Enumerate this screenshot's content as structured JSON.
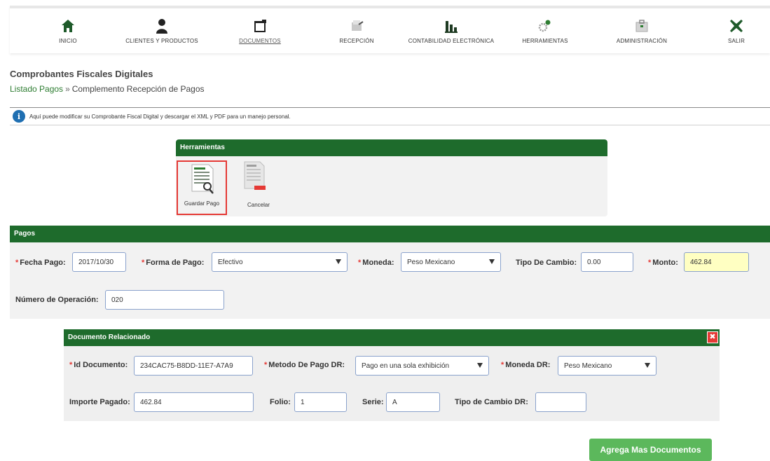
{
  "nav": {
    "items": [
      {
        "label": "INICIO",
        "icon": "home-icon"
      },
      {
        "label": "CLIENTES Y PRODUCTOS",
        "icon": "person-icon"
      },
      {
        "label": "DOCUMENTOS",
        "icon": "folder-icon"
      },
      {
        "label": "RECEPCIÓN",
        "icon": "inbox-icon"
      },
      {
        "label": "CONTABILIDAD ELECTRÓNICA",
        "icon": "bar-chart-icon"
      },
      {
        "label": "HERRAMIENTAS",
        "icon": "gears-icon"
      },
      {
        "label": "ADMINISTRACIÓN",
        "icon": "briefcase-icon"
      },
      {
        "label": "SALIR",
        "icon": "exit-x-icon"
      }
    ],
    "active": "DOCUMENTOS"
  },
  "header": {
    "title": "Comprobantes Fiscales Digitales",
    "breadcrumb_link": "Listado Pagos",
    "breadcrumb_sep": "»",
    "breadcrumb_current": "Complemento Recepción de Pagos"
  },
  "info": {
    "text": "Aquí puede modificar su Comprobante Fiscal Digital y descargar el XML y PDF para un manejo personal."
  },
  "tools": {
    "title": "Herramientas",
    "save_label": "Guardar Pago",
    "cancel_label": "Cancelar"
  },
  "pagos": {
    "title": "Pagos",
    "fecha_label": "Fecha Pago:",
    "fecha_value": "2017/10/30",
    "forma_label": "Forma de Pago:",
    "forma_value": "Efectivo",
    "moneda_label": "Moneda:",
    "moneda_value": "Peso Mexicano",
    "tipo_cambio_label": "Tipo De Cambio:",
    "tipo_cambio_value": "0.00",
    "monto_label": "Monto:",
    "monto_value": "462.84",
    "num_op_label": "Número de Operación:",
    "num_op_value": "020"
  },
  "docrel": {
    "title": "Documento Relacionado",
    "close": "✖",
    "id_label": "Id Documento:",
    "id_value": "234CAC75-B8DD-11E7-A7A9",
    "metodo_label": "Metodo De Pago DR:",
    "metodo_value": "Pago en una sola exhibición",
    "moneda_label": "Moneda DR:",
    "moneda_value": "Peso Mexicano",
    "importe_label": "Importe Pagado:",
    "importe_value": "462.84",
    "folio_label": "Folio:",
    "folio_value": "1",
    "serie_label": "Serie:",
    "serie_value": "A",
    "tipo_cambio_label": "Tipo de Cambio DR:",
    "tipo_cambio_value": ""
  },
  "add_button": "Agrega Mas Documentos",
  "colors": {
    "header_green": "#1e6b2c",
    "button_green": "#5cb85c",
    "required_red": "#e53935",
    "link_green": "#2e7d32",
    "info_blue": "#1f6fb2"
  }
}
